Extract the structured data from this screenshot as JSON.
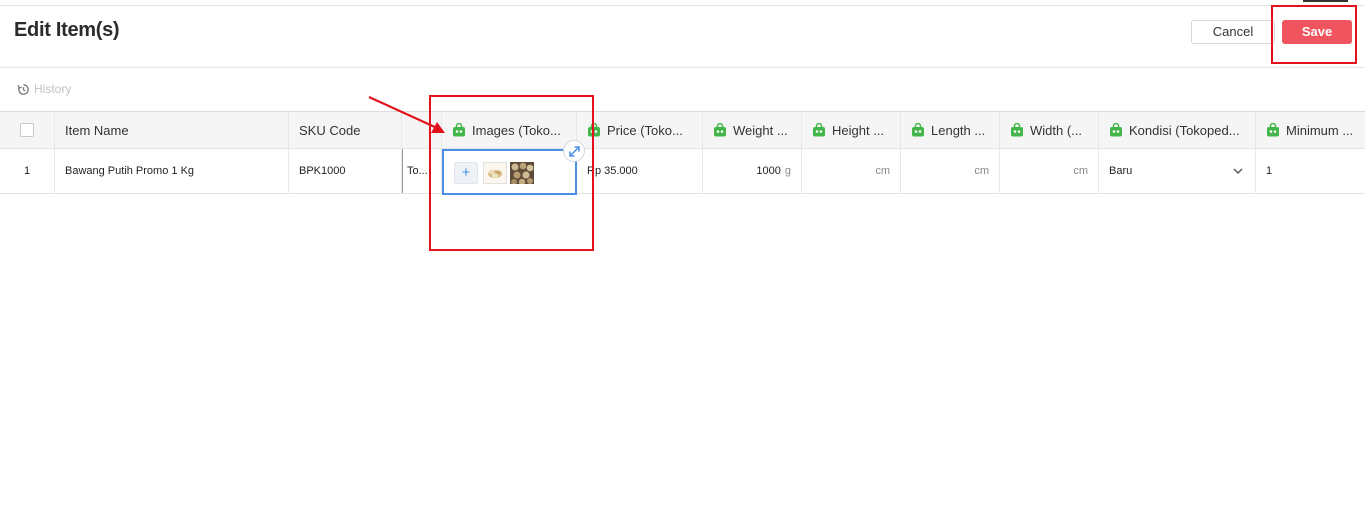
{
  "header": {
    "title": "Edit Item(s)",
    "cancel_label": "Cancel",
    "save_label": "Save"
  },
  "history_label": "History",
  "table": {
    "columns": [
      "Item Name",
      "SKU Code",
      "Images (Toko...",
      "Price (Toko...",
      "Weight ...",
      "Height ...",
      "Length ...",
      "Width (...",
      "Kondisi (Tokoped...",
      "Minimum ..."
    ],
    "rows": [
      {
        "index": "1",
        "item_name": "Bawang Putih Promo 1 Kg",
        "sku": "BPK1000",
        "truncated": "To...",
        "price": "Rp 35.000",
        "weight": "1000",
        "weight_unit": "g",
        "height_unit": "cm",
        "length_unit": "cm",
        "width_unit": "cm",
        "kondisi": "Baru",
        "minimum": "1"
      }
    ]
  },
  "image_editor": {
    "add_symbol": "+",
    "thumbnails": [
      "garlic-photo",
      "garlic-photo"
    ]
  },
  "colors": {
    "save": "#f0555f",
    "annotation": "#e3111b",
    "editor_border": "#4a90e2"
  }
}
